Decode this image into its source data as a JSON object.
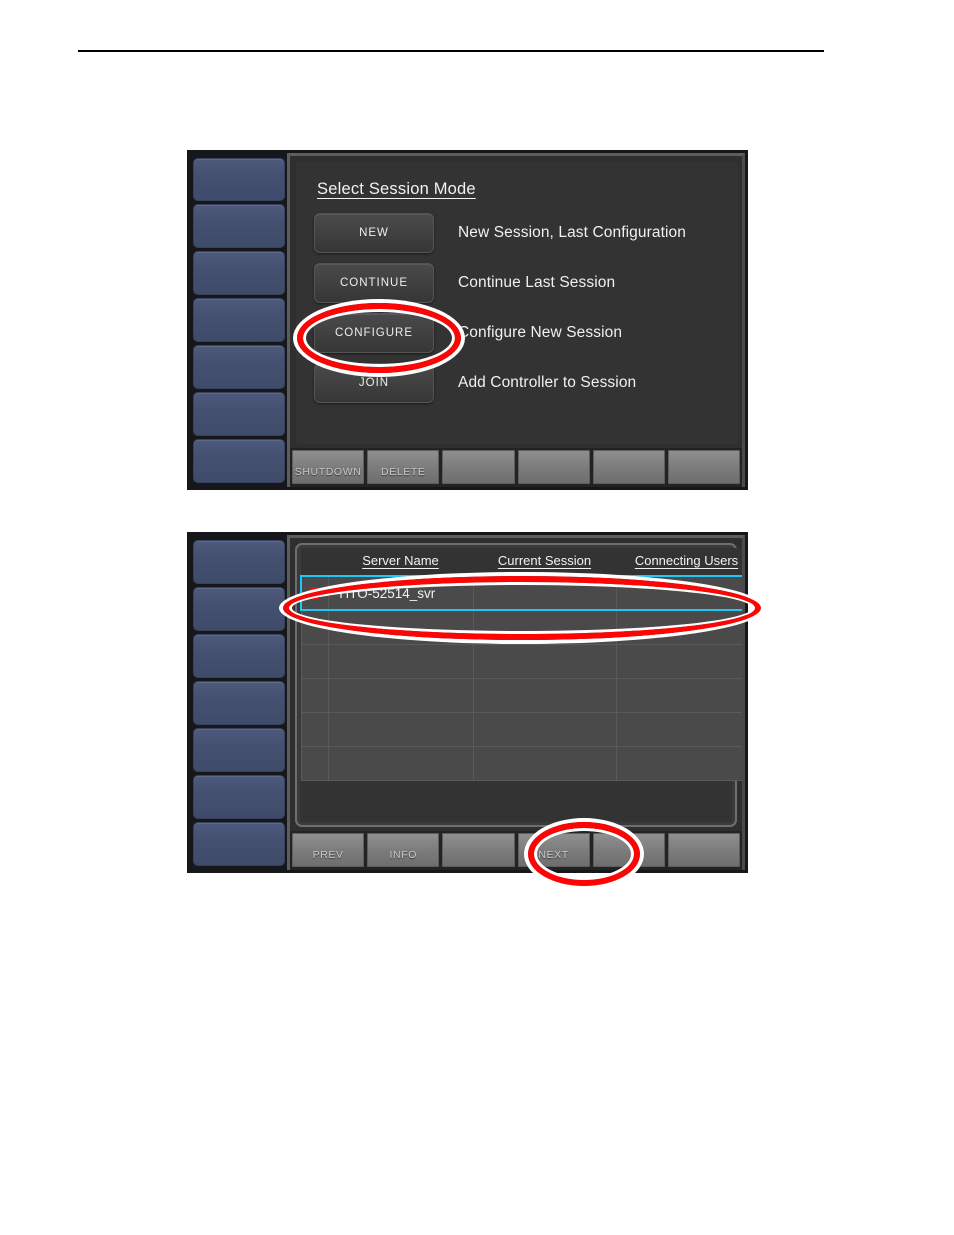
{
  "document": {
    "rule": "horizontal-rule"
  },
  "panels": [
    {
      "id": "session-mode",
      "screen_title": "Select Session Mode",
      "sidebar_key_count": 7,
      "options": [
        {
          "button": "NEW",
          "description": "New Session, Last Configuration"
        },
        {
          "button": "CONTINUE",
          "description": "Continue Last Session"
        },
        {
          "button": "CONFIGURE",
          "description": "Configure New Session"
        },
        {
          "button": "JOIN",
          "description": "Add Controller to Session"
        }
      ],
      "softkeys": [
        "SHUTDOWN",
        "DELETE",
        "",
        "",
        "",
        ""
      ],
      "annotation": {
        "target": "CONFIGURE",
        "shape": "ellipse",
        "color": "#fb0505"
      }
    },
    {
      "id": "server-select",
      "sidebar_key_count": 7,
      "table": {
        "columns": [
          "",
          "Server Name",
          "Current Session",
          "Connecting Users"
        ],
        "rows": [
          {
            "status": "red-dot",
            "server_name": "YITO-52514_svr",
            "current_session": "",
            "connecting_users": "",
            "selected": true
          },
          {
            "status": "",
            "server_name": "",
            "current_session": "",
            "connecting_users": "",
            "selected": false
          },
          {
            "status": "",
            "server_name": "",
            "current_session": "",
            "connecting_users": "",
            "selected": false
          },
          {
            "status": "",
            "server_name": "",
            "current_session": "",
            "connecting_users": "",
            "selected": false
          },
          {
            "status": "",
            "server_name": "",
            "current_session": "",
            "connecting_users": "",
            "selected": false
          },
          {
            "status": "",
            "server_name": "",
            "current_session": "",
            "connecting_users": "",
            "selected": false
          }
        ]
      },
      "softkeys": [
        "PREV",
        "INFO",
        "",
        "NEXT",
        "",
        ""
      ],
      "annotations": [
        {
          "target": "YITO-52514_svr row",
          "shape": "ellipse",
          "color": "#fb0505"
        },
        {
          "target": "NEXT",
          "shape": "ellipse",
          "color": "#fb0505"
        }
      ]
    }
  ],
  "colors": {
    "annotation_red": "#fb0505",
    "selection_cyan": "#1ec8f5",
    "status_dot_red": "#ee1111",
    "sidebar_blue": "#455171",
    "screen_bg": "#2f2f2f"
  }
}
